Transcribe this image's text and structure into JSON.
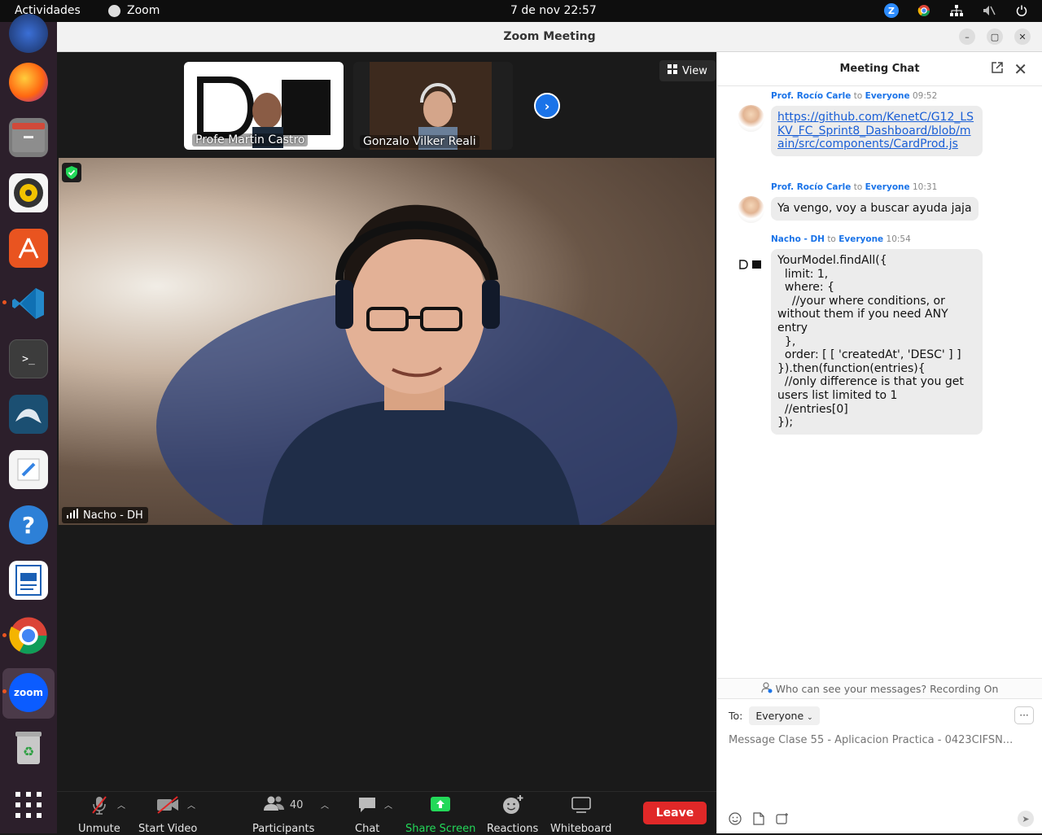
{
  "topbar": {
    "activities": "Actividades",
    "app_name": "Zoom",
    "clock": "7 de nov  22:57"
  },
  "window": {
    "title": "Zoom Meeting"
  },
  "meeting": {
    "thumbnails": [
      {
        "name": "Profe Martin Castro"
      },
      {
        "name": "Gonzalo Vilker Reali"
      }
    ],
    "view_label": "View",
    "main_speaker": "Nacho - DH"
  },
  "toolbar": {
    "unmute": "Unmute",
    "start_video": "Start Video",
    "participants": "Participants",
    "participants_count": "40",
    "chat": "Chat",
    "share_screen": "Share Screen",
    "reactions": "Reactions",
    "whiteboard": "Whiteboard",
    "leave": "Leave",
    "share_color": "#23d959",
    "leave_color": "#e02828"
  },
  "chat": {
    "title": "Meeting Chat",
    "messages": [
      {
        "sender": "Prof. Rocío Carle",
        "to_word": "to",
        "recipient": "Everyone",
        "time": "09:52",
        "text": "https://github.com/KenetC/G12_LSKV_FC_Sprint8_Dashboard/blob/main/src/components/CardProd.js"
      },
      {
        "sender": "Prof. Rocío Carle",
        "to_word": "to",
        "recipient": "Everyone",
        "time": "10:31",
        "text": "Ya vengo, voy a buscar ayuda jaja"
      },
      {
        "sender": "Nacho - DH",
        "to_word": "to",
        "recipient": "Everyone",
        "time": "10:54",
        "text": "YourModel.findAll({\n  limit: 1,\n  where: {\n    //your where conditions, or without them if you need ANY entry\n  },\n  order: [ [ 'createdAt', 'DESC' ] ]\n}).then(function(entries){\n  //only difference is that you get users list limited to 1\n  //entries[0]\n});"
      }
    ],
    "notice": "Who can see your messages? Recording On",
    "to_label": "To:",
    "to_value": "Everyone",
    "input_placeholder": "Message Clase 55 - Aplicacion Practica - 0423CIFSN..."
  }
}
